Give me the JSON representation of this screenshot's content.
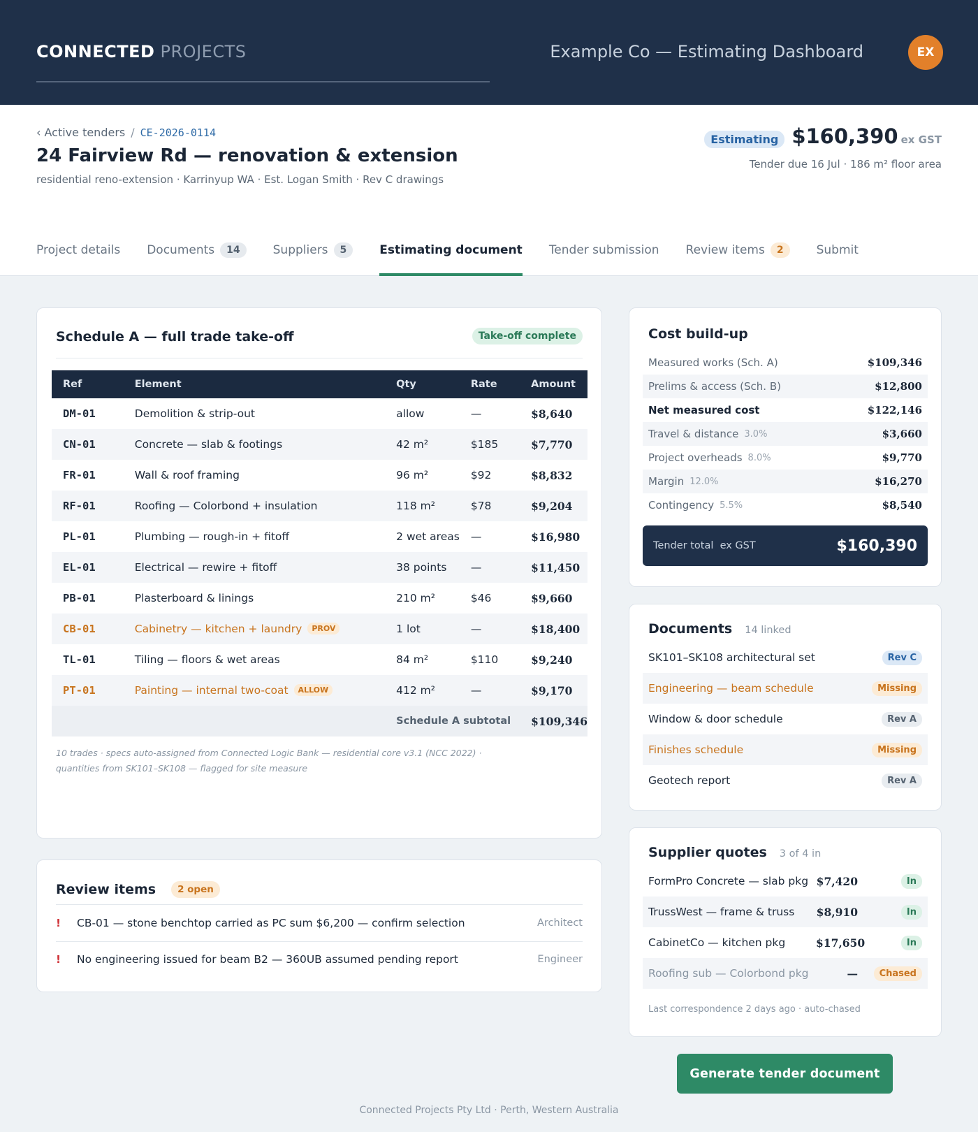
{
  "header": {
    "brand_primary": "CONNECTED",
    "brand_secondary": "PROJECTS",
    "dashboard_title": "Example Co — Estimating Dashboard",
    "avatar_initials": "EX"
  },
  "project": {
    "breadcrumb_parent": "‹ Active tenders",
    "breadcrumb_sep": "/",
    "breadcrumb_code": "CE-2026-0114",
    "title": "24 Fairview Rd — renovation & extension",
    "subtitle": "residential reno-extension · Karrinyup WA · Est. Logan Smith · Rev C drawings",
    "status": "Estimating",
    "total": "$160,390",
    "total_suffix": "ex GST",
    "due_line": "Tender due 16 Jul · 186 m² floor area"
  },
  "tabs": [
    {
      "label": "Project details",
      "count": ""
    },
    {
      "label": "Documents",
      "count": "14"
    },
    {
      "label": "Suppliers",
      "count": "5"
    },
    {
      "label": "Estimating document",
      "count": ""
    },
    {
      "label": "Tender submission",
      "count": ""
    },
    {
      "label": "Review items",
      "count": "2"
    },
    {
      "label": "Submit",
      "count": ""
    }
  ],
  "schedule": {
    "title": "Schedule A — full trade take-off",
    "status": "Take-off complete",
    "columns": [
      "Ref",
      "Element",
      "Qty",
      "Rate",
      "Amount"
    ],
    "rows": [
      {
        "ref": "DM-01",
        "element": "Demolition & strip-out",
        "tag": "",
        "qty": "allow",
        "rate": "—",
        "amount": "$8,640"
      },
      {
        "ref": "CN-01",
        "element": "Concrete — slab & footings",
        "tag": "",
        "qty": "42 m²",
        "rate": "$185",
        "amount": "$7,770"
      },
      {
        "ref": "FR-01",
        "element": "Wall & roof framing",
        "tag": "",
        "qty": "96 m²",
        "rate": "$92",
        "amount": "$8,832"
      },
      {
        "ref": "RF-01",
        "element": "Roofing — Colorbond + insulation",
        "tag": "",
        "qty": "118 m²",
        "rate": "$78",
        "amount": "$9,204"
      },
      {
        "ref": "PL-01",
        "element": "Plumbing — rough-in + fitoff",
        "tag": "",
        "qty": "2 wet areas",
        "rate": "—",
        "amount": "$16,980"
      },
      {
        "ref": "EL-01",
        "element": "Electrical — rewire + fitoff",
        "tag": "",
        "qty": "38 points",
        "rate": "—",
        "amount": "$11,450"
      },
      {
        "ref": "PB-01",
        "element": "Plasterboard & linings",
        "tag": "",
        "qty": "210 m²",
        "rate": "$46",
        "amount": "$9,660"
      },
      {
        "ref": "CB-01",
        "element": "Cabinetry — kitchen + laundry",
        "tag": "PROV",
        "qty": "1 lot",
        "rate": "—",
        "amount": "$18,400"
      },
      {
        "ref": "TL-01",
        "element": "Tiling — floors & wet areas",
        "tag": "",
        "qty": "84 m²",
        "rate": "$110",
        "amount": "$9,240"
      },
      {
        "ref": "PT-01",
        "element": "Painting — internal two-coat",
        "tag": "ALLOW",
        "qty": "412 m²",
        "rate": "—",
        "amount": "$9,170"
      }
    ],
    "subtotal_label": "Schedule A subtotal",
    "subtotal": "$109,346",
    "note_line1": "10 trades · specs auto-assigned from Connected Logic Bank — residential core v3.1 (NCC 2022) ·",
    "note_line2": "quantities from SK101–SK108 — flagged for site measure"
  },
  "review": {
    "title": "Review items",
    "open": "2 open",
    "items": [
      {
        "text": "CB-01 — stone benchtop carried as PC sum $6,200 — confirm selection",
        "who": "Architect"
      },
      {
        "text": "No engineering issued for beam B2 — 360UB assumed pending report",
        "who": "Engineer"
      }
    ]
  },
  "cost": {
    "title": "Cost build-up",
    "rows": [
      {
        "label": "Measured works (Sch. A)",
        "pct": "",
        "value": "$109,346"
      },
      {
        "label": "Prelims & access (Sch. B)",
        "pct": "",
        "value": "$12,800"
      },
      {
        "label": "Net measured cost",
        "pct": "",
        "value": "$122,146"
      },
      {
        "label": "Travel & distance",
        "pct": "3.0%",
        "value": "$3,660"
      },
      {
        "label": "Project overheads",
        "pct": "8.0%",
        "value": "$9,770"
      },
      {
        "label": "Margin",
        "pct": "12.0%",
        "value": "$16,270"
      },
      {
        "label": "Contingency",
        "pct": "5.5%",
        "value": "$8,540"
      }
    ],
    "total_label": "Tender total  ex GST",
    "total": "$160,390"
  },
  "documents": {
    "title": "Documents",
    "sub": "14 linked",
    "items": [
      {
        "name": "SK101–SK108 architectural set",
        "badge": "Rev C"
      },
      {
        "name": "Engineering — beam schedule",
        "badge": "Missing"
      },
      {
        "name": "Window & door schedule",
        "badge": "Rev A"
      },
      {
        "name": "Finishes schedule",
        "badge": "Missing"
      },
      {
        "name": "Geotech report",
        "badge": "Rev A"
      }
    ]
  },
  "suppliers": {
    "title": "Supplier quotes",
    "sub": "3 of 4 in",
    "items": [
      {
        "name": "FormPro Concrete — slab pkg",
        "amount": "$7,420",
        "status": "In"
      },
      {
        "name": "TrussWest — frame & truss",
        "amount": "$8,910",
        "status": "In"
      },
      {
        "name": "CabinetCo — kitchen pkg",
        "amount": "$17,650",
        "status": "In"
      },
      {
        "name": "Roofing sub — Colorbond pkg",
        "amount": "—",
        "status": "Chased"
      }
    ],
    "note": "Last correspondence 2 days ago · auto-chased"
  },
  "actions": {
    "generate": "Generate tender document"
  },
  "footer": "Connected Projects Pty Ltd · Perth, Western Australia",
  "colors": {
    "navy": "#1f3049",
    "accent_green": "#2e8a66",
    "warning_orange": "#c8741e",
    "link_blue": "#2e6aa6",
    "avatar_orange": "#e2802a"
  }
}
